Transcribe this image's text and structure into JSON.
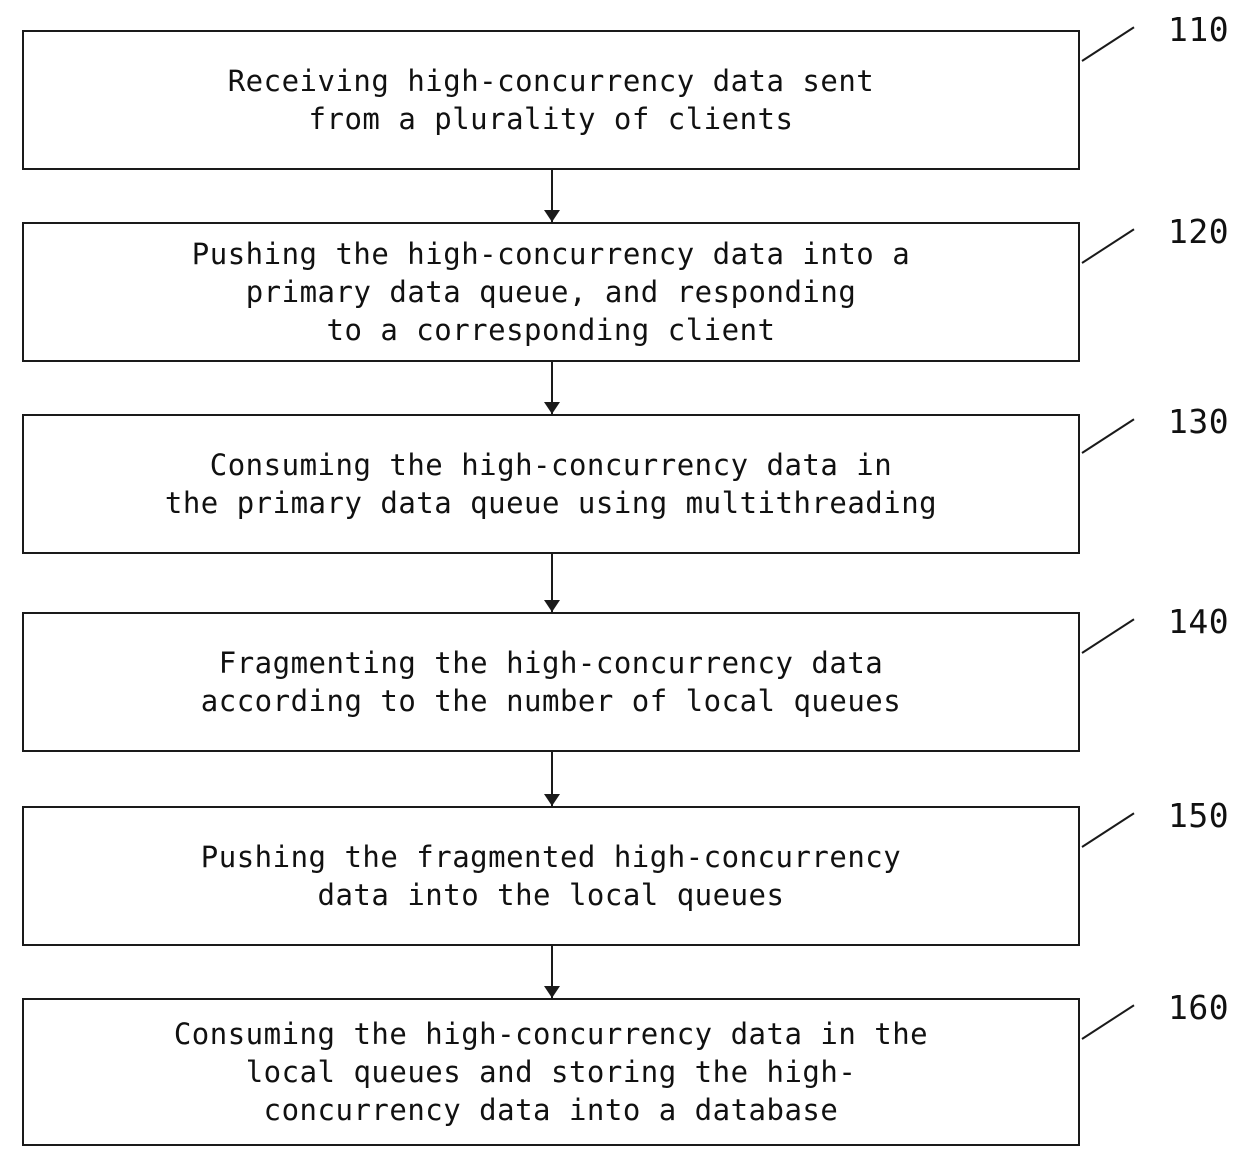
{
  "diagram": {
    "type": "flowchart",
    "orientation": "vertical",
    "steps": [
      {
        "ref": "110",
        "lines": [
          "Receiving high-concurrency data sent",
          "from a plurality of clients"
        ]
      },
      {
        "ref": "120",
        "lines": [
          "Pushing the high-concurrency data into a",
          "primary data queue, and responding",
          "to a corresponding client"
        ]
      },
      {
        "ref": "130",
        "lines": [
          "Consuming the high-concurrency data in",
          "the primary data queue using multithreading"
        ]
      },
      {
        "ref": "140",
        "lines": [
          "Fragmenting the high-concurrency data",
          "according to the number of local queues"
        ]
      },
      {
        "ref": "150",
        "lines": [
          "Pushing the fragmented high-concurrency",
          "data into the local queues"
        ]
      },
      {
        "ref": "160",
        "lines": [
          "Consuming the high-concurrency data in the",
          "local queues and storing the high-",
          "concurrency data into a database"
        ]
      }
    ],
    "colors": {
      "stroke": "#1a1a1a",
      "background": "#ffffff",
      "text": "#111111"
    }
  }
}
